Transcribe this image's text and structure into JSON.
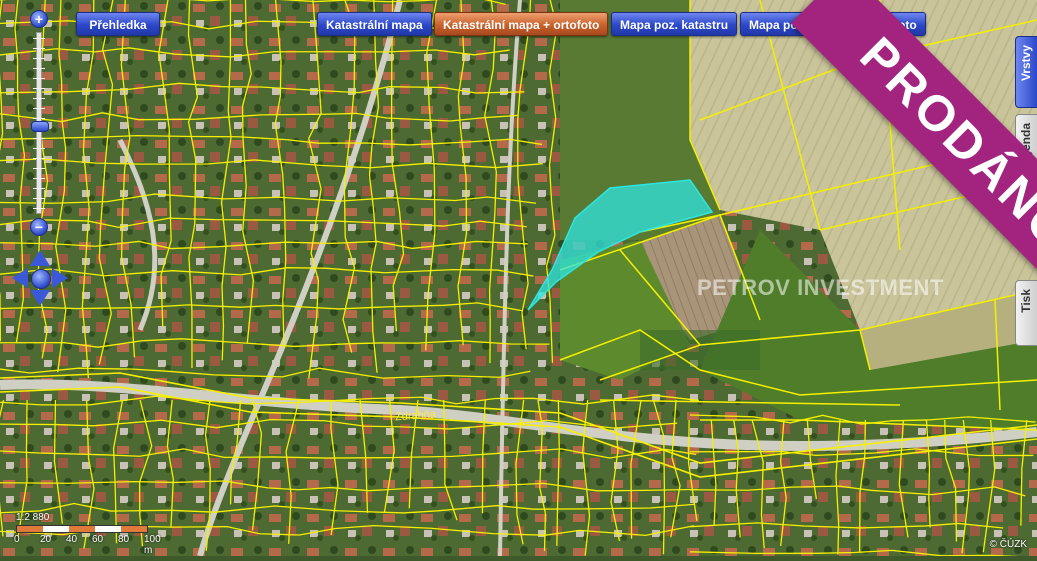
{
  "toolbar": {
    "overview_label": "Přehledka",
    "layers": [
      {
        "label": "Katastrální mapa",
        "active": false
      },
      {
        "label": "Katastrální mapa + ortofoto",
        "active": true
      },
      {
        "label": "Mapa poz. katastru",
        "active": false
      },
      {
        "label": "Mapa poz. katastru + ortofoto",
        "active": false
      }
    ]
  },
  "zoom": {
    "in_label": "+",
    "out_label": "−",
    "level_fraction": 0.52
  },
  "side_tabs": {
    "layers_label": "Vrstvy",
    "legend_label": "Legenda",
    "print_label": "Tisk"
  },
  "scale": {
    "ratio": "1:2 880",
    "labels": [
      "0",
      "20",
      "40",
      "60",
      "80",
      "100 m"
    ]
  },
  "map": {
    "street_label": "Zdrahňa",
    "copyright": "© ČÚZK",
    "parcel_line_color": "#f5f000",
    "highlight_color": "#2ee6e0"
  },
  "overlay": {
    "watermark": "PETROV INVESTMENT",
    "banner": "PRODÁNO",
    "banner_color": "#a2247e"
  },
  "icons": {
    "zoom_in": "plus-icon",
    "zoom_out": "minus-icon",
    "pan": "pan-arrows-icon"
  }
}
